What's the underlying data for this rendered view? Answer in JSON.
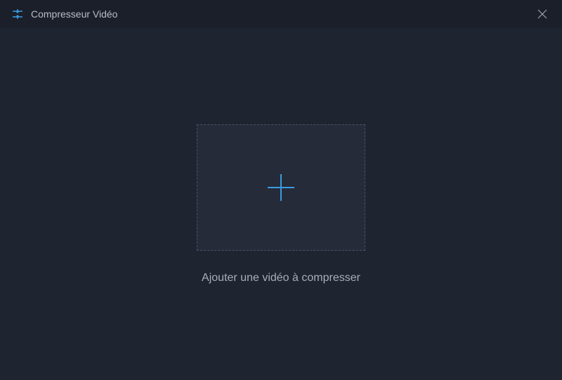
{
  "header": {
    "title": "Compresseur Vidéo"
  },
  "main": {
    "instruction": "Ajouter une vidéo à compresser"
  },
  "colors": {
    "accent": "#3a9be0"
  }
}
